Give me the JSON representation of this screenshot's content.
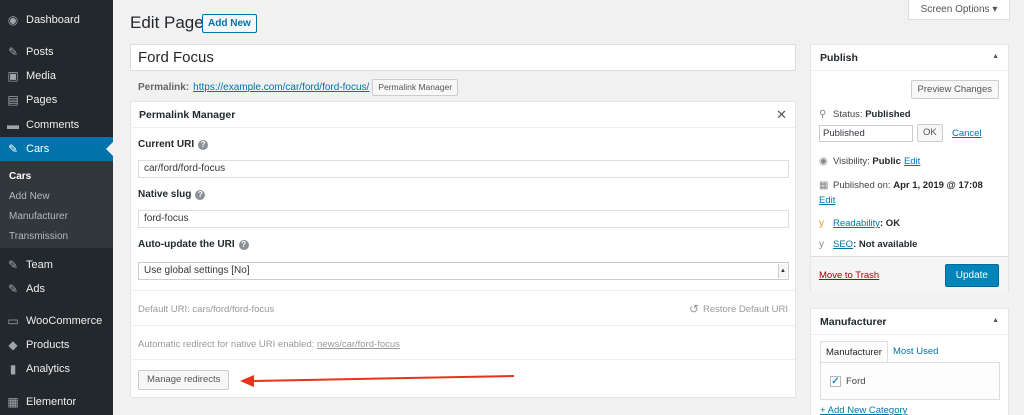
{
  "sidebar": {
    "items": [
      {
        "label": "Dashboard",
        "icon": "dashboard-icon",
        "glyph": "◉"
      },
      {
        "label": "Posts",
        "icon": "pin-icon",
        "glyph": "✎"
      },
      {
        "label": "Media",
        "icon": "media-icon",
        "glyph": "▣"
      },
      {
        "label": "Pages",
        "icon": "pages-icon",
        "glyph": "▤"
      },
      {
        "label": "Comments",
        "icon": "comments-icon",
        "glyph": "▬"
      },
      {
        "label": "Cars",
        "icon": "pin-icon",
        "glyph": "✎"
      },
      {
        "label": "Team",
        "icon": "pin-icon",
        "glyph": "✎"
      },
      {
        "label": "Ads",
        "icon": "pin-icon",
        "glyph": "✎"
      },
      {
        "label": "WooCommerce",
        "icon": "woocommerce-icon",
        "glyph": "▭"
      },
      {
        "label": "Products",
        "icon": "products-icon",
        "glyph": "◆"
      },
      {
        "label": "Analytics",
        "icon": "analytics-icon",
        "glyph": "▮"
      },
      {
        "label": "Elementor",
        "icon": "elementor-icon",
        "glyph": "▦"
      }
    ],
    "submenu": [
      "Cars",
      "Add New",
      "Manufacturer",
      "Transmission"
    ]
  },
  "header": {
    "title": "Edit Page",
    "add_new": "Add New",
    "screen_options": "Screen Options ▾"
  },
  "post": {
    "title": "Ford Focus",
    "permalink_label": "Permalink:",
    "permalink_url": "https://example.com/car/ford/ford-focus/",
    "permalink_manager_button": "Permalink Manager"
  },
  "permalink_manager": {
    "title": "Permalink Manager",
    "close": "✕",
    "current_uri_label": "Current URI",
    "current_uri_value": "car/ford/ford-focus",
    "native_slug_label": "Native slug",
    "native_slug_value": "ford-focus",
    "auto_update_label": "Auto-update the URI",
    "auto_update_value": "Use global settings [No]",
    "default_uri_text": "Default URI: cars/ford/ford-focus",
    "restore_default": "Restore Default URI",
    "redirect_text": "Automatic redirect for native URI enabled:",
    "redirect_link": "news/car/ford-focus",
    "manage_redirects": "Manage redirects",
    "help_glyph": "?"
  },
  "publish": {
    "title": "Publish",
    "preview_changes": "Preview Changes",
    "status_label": "Status:",
    "status_value": "Published",
    "status_select": "Published",
    "ok": "OK",
    "cancel": "Cancel",
    "visibility_label": "Visibility:",
    "visibility_value": "Public",
    "edit": "Edit",
    "published_on_label": "Published on:",
    "published_on_value": "Apr 1, 2019 @ 17:08",
    "readability_link": "Readability",
    "readability_value": ": OK",
    "seo_link": "SEO",
    "seo_value": ": Not available",
    "move_to_trash": "Move to Trash",
    "update": "Update"
  },
  "manufacturer": {
    "title": "Manufacturer",
    "tab_all": "Manufacturer",
    "tab_most_used": "Most Used",
    "item": "Ford",
    "add_new_category": "+ Add New Category"
  },
  "colors": {
    "sidebar_bg": "#23282d",
    "active_menu": "#0073aa",
    "link": "#0073aa",
    "primary_button": "#0085ba",
    "annotation_arrow": "#e8321c"
  }
}
